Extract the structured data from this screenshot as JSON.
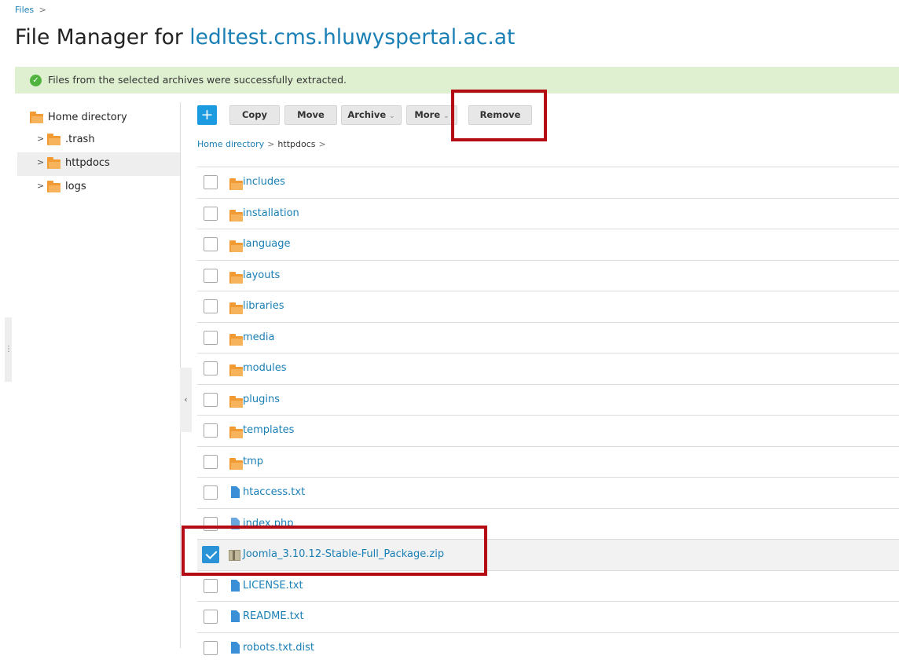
{
  "breadcrumb_top": {
    "label": "Files",
    "sep": ">"
  },
  "title": {
    "prefix": "File Manager for ",
    "domain": "ledltest.cms.hluwyspertal.ac.at"
  },
  "alert": {
    "message": "Files from the selected archives were successfully extracted.",
    "icon": "check-circle-icon",
    "color": "#4fb33d"
  },
  "tree": {
    "root": "Home directory",
    "children": [
      {
        "label": ".trash",
        "selected": false
      },
      {
        "label": "httpdocs",
        "selected": true
      },
      {
        "label": "logs",
        "selected": false
      }
    ]
  },
  "toolbar": {
    "add": "+",
    "copy": "Copy",
    "move": "Move",
    "archive": "Archive",
    "more": "More",
    "remove": "Remove",
    "caret": "⌄"
  },
  "path": {
    "home": "Home directory",
    "current": "httpdocs",
    "sep": ">"
  },
  "files": [
    {
      "name": "includes",
      "type": "folder"
    },
    {
      "name": "installation",
      "type": "folder"
    },
    {
      "name": "language",
      "type": "folder"
    },
    {
      "name": "layouts",
      "type": "folder"
    },
    {
      "name": "libraries",
      "type": "folder"
    },
    {
      "name": "media",
      "type": "folder"
    },
    {
      "name": "modules",
      "type": "folder"
    },
    {
      "name": "plugins",
      "type": "folder"
    },
    {
      "name": "templates",
      "type": "folder"
    },
    {
      "name": "tmp",
      "type": "folder"
    },
    {
      "name": "htaccess.txt",
      "type": "file"
    },
    {
      "name": "index.php",
      "type": "php"
    },
    {
      "name": "Joomla_3.10.12-Stable-Full_Package.zip",
      "type": "zip",
      "selected": true
    },
    {
      "name": "LICENSE.txt",
      "type": "file"
    },
    {
      "name": "README.txt",
      "type": "file"
    },
    {
      "name": "robots.txt.dist",
      "type": "file"
    }
  ],
  "colors": {
    "accent": "#1a7fb5",
    "highlight": "#b40c14",
    "folder": "#f29b34",
    "success_bg": "#dff0d0"
  }
}
